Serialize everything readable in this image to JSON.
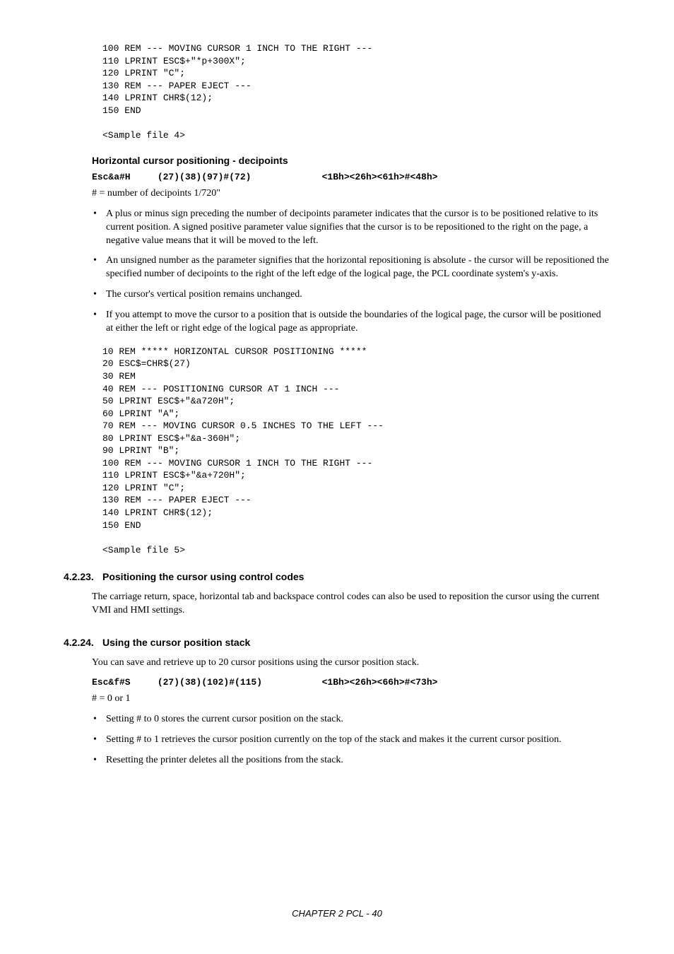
{
  "code_block_1": "100 REM --- MOVING CURSOR 1 INCH TO THE RIGHT ---\n110 LPRINT ESC$+\"*p+300X\";\n120 LPRINT \"C\";\n130 REM --- PAPER EJECT ---\n140 LPRINT CHR$(12);\n150 END\n\n<Sample file 4>",
  "section_deci": {
    "title": "Horizontal cursor positioning - decipoints",
    "cmd_name": "Esc&a#H",
    "cmd_dec": "(27)(38)(97)#(72)",
    "cmd_hex": "<1Bh><26h><61h>#<48h>",
    "hash_desc": "# = number of decipoints 1/720\"",
    "bullets": [
      "A plus or minus sign preceding the number of decipoints parameter indicates that the cursor is to be positioned relative to its current position. A signed positive parameter value signifies that the cursor is to be repositioned to the right on the page, a negative value means that it will be moved to the left.",
      "An unsigned number as the parameter signifies that the horizontal repositioning is absolute - the cursor will be repositioned the specified number of decipoints to the right of the left edge of the logical page, the PCL coordinate system's y-axis.",
      "The cursor's vertical position remains unchanged.",
      "If you attempt to move the cursor to a position that is outside the boundaries of the logical page, the cursor will be positioned at either the left or right edge of the logical page as appropriate."
    ]
  },
  "code_block_2": "10 REM ***** HORIZONTAL CURSOR POSITIONING *****\n20 ESC$=CHR$(27)\n30 REM\n40 REM --- POSITIONING CURSOR AT 1 INCH ---\n50 LPRINT ESC$+\"&a720H\";\n60 LPRINT \"A\";\n70 REM --- MOVING CURSOR 0.5 INCHES TO THE LEFT ---\n80 LPRINT ESC$+\"&a-360H\";\n90 LPRINT \"B\";\n100 REM --- MOVING CURSOR 1 INCH TO THE RIGHT ---\n110 LPRINT ESC$+\"&a+720H\";\n120 LPRINT \"C\";\n130 REM --- PAPER EJECT ---\n140 LPRINT CHR$(12);\n150 END\n\n<Sample file 5>",
  "section_4223": {
    "number": "4.2.23.",
    "title": "Positioning the cursor using control codes",
    "body": "The carriage return, space, horizontal tab and backspace control codes can also be used to reposition the cursor using the current VMI and HMI settings."
  },
  "section_4224": {
    "number": "4.2.24.",
    "title": "Using the cursor position stack",
    "body": "You can save and retrieve up to 20 cursor positions using the cursor position stack.",
    "cmd_name": "Esc&f#S",
    "cmd_dec": "(27)(38)(102)#(115)",
    "cmd_hex": "<1Bh><26h><66h>#<73h>",
    "hash_desc": "# = 0 or 1",
    "bullets": [
      "Setting # to 0 stores the current cursor position on the stack.",
      "Setting # to 1 retrieves the cursor position currently on the top of the stack and makes it the current cursor position.",
      "Resetting the printer deletes all the positions from the stack."
    ]
  },
  "footer": "CHAPTER 2 PCL - 40"
}
